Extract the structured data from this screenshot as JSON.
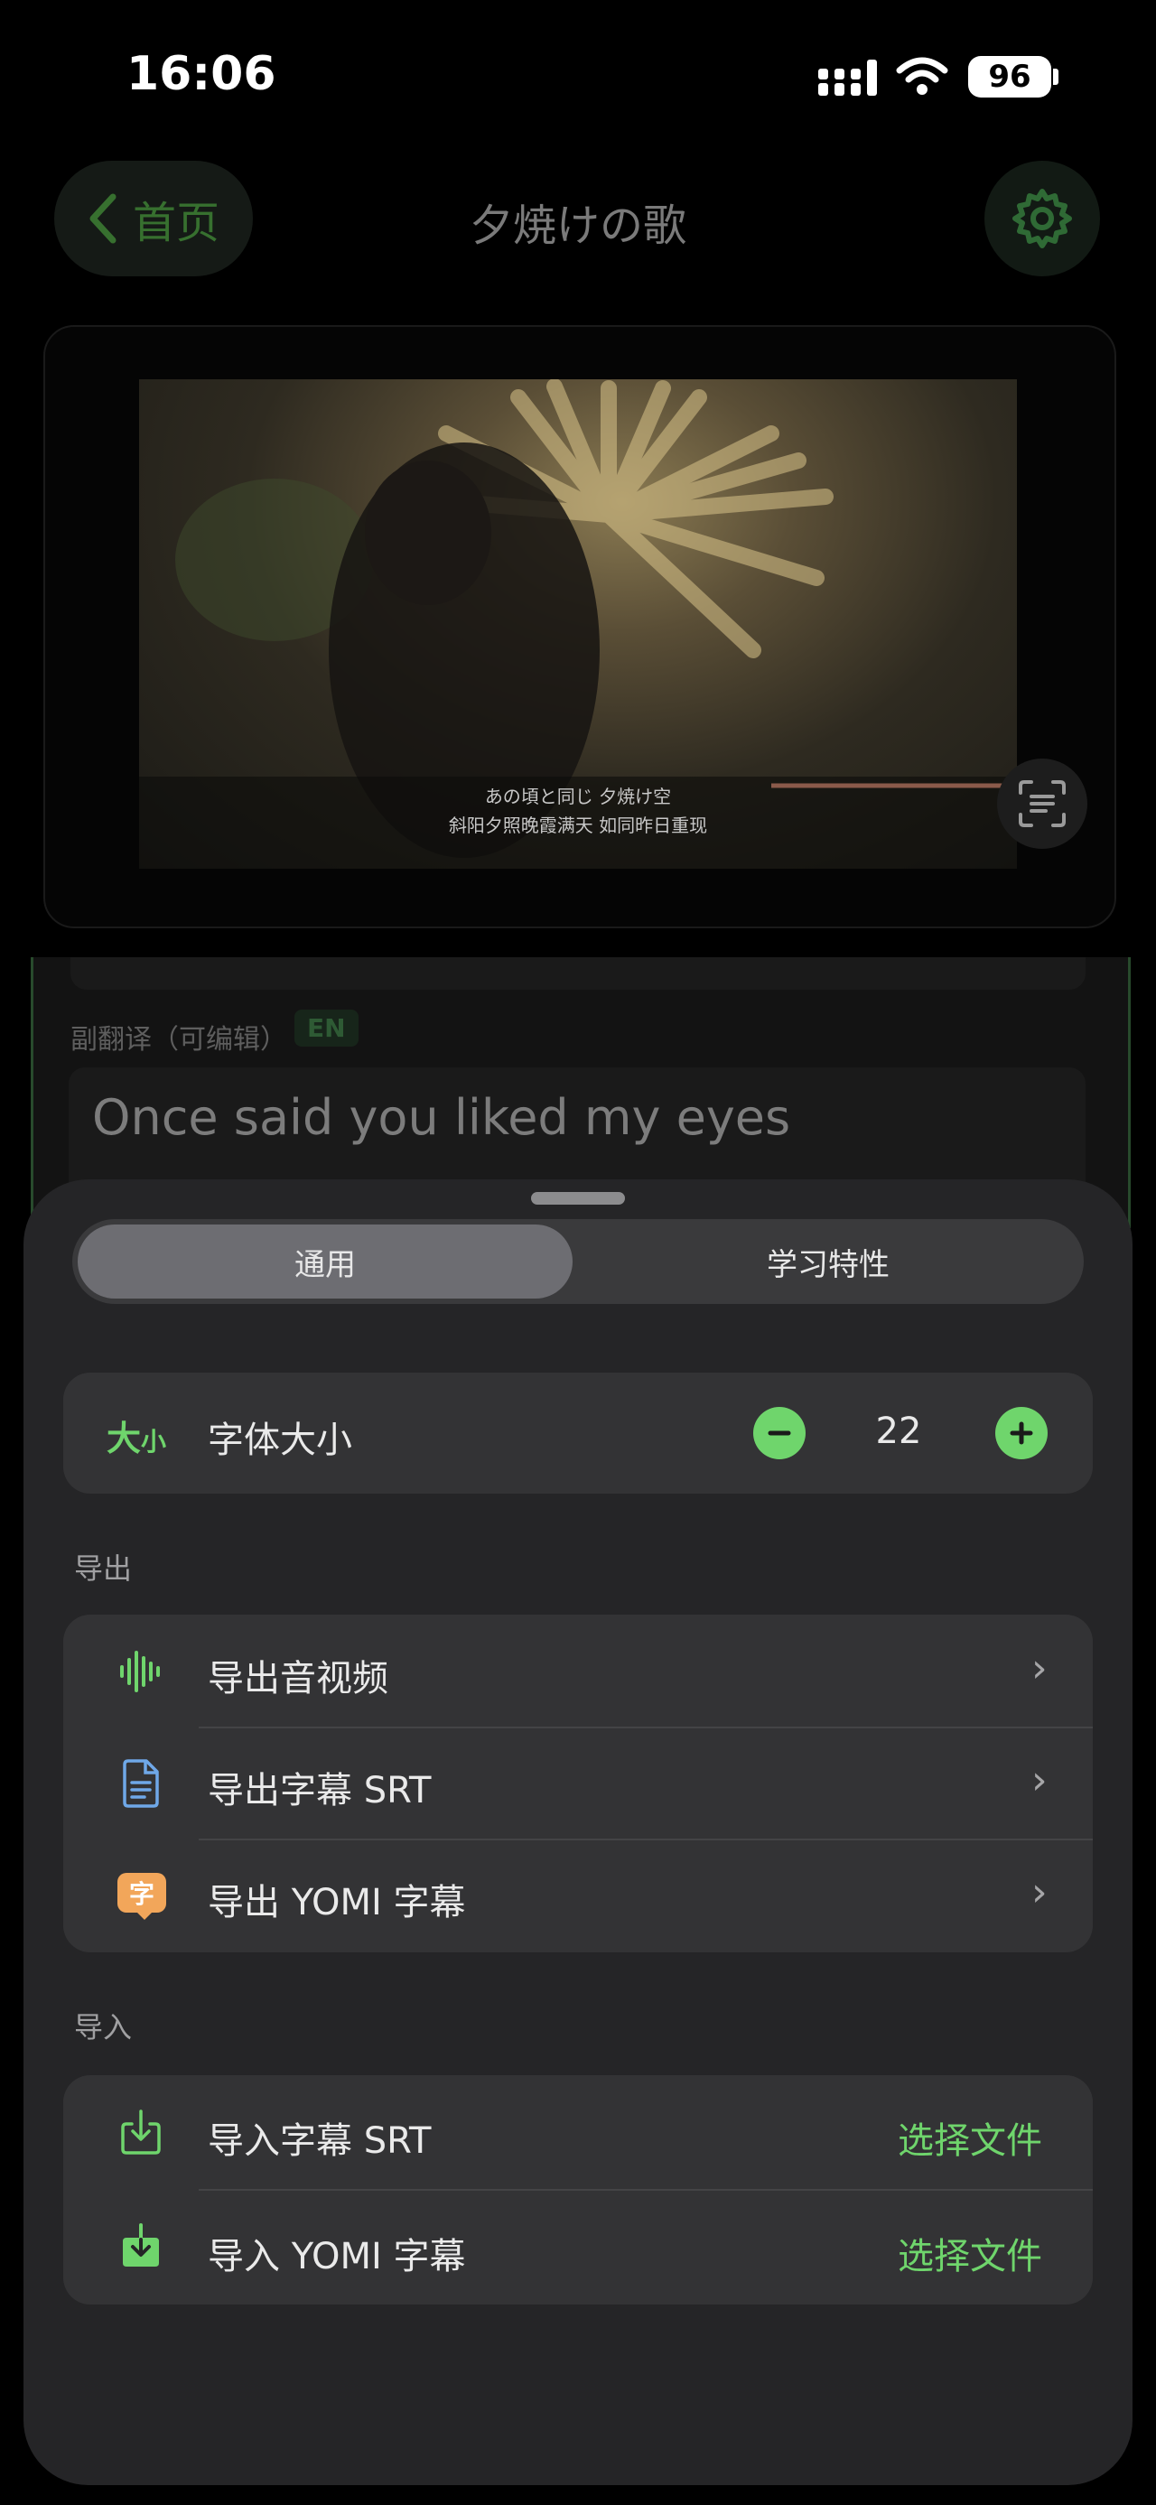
{
  "status_bar": {
    "time": "16:06",
    "battery": "96"
  },
  "nav": {
    "back_label": "首页",
    "title": "夕焼けの歌"
  },
  "video": {
    "subtitle_original": "あの頃と同じ 夕焼け空",
    "subtitle_translation": "斜阳夕照晚霞满天 如同昨日重现"
  },
  "editor": {
    "secondary_label": "副翻译（可编辑）",
    "language_badge": "EN",
    "secondary_text": "Once said you liked my eyes"
  },
  "sheet": {
    "tabs": [
      "通用",
      "学习特性"
    ],
    "font_size": {
      "icon_big": "大",
      "icon_small": "小",
      "label": "字体大小",
      "value": "22"
    },
    "export_section": "导出",
    "export_items": [
      "导出音视频",
      "导出字幕 SRT",
      "导出 YOMI 字幕"
    ],
    "export_yomi_icon_char": "字",
    "import_section": "导入",
    "import_items": [
      {
        "label": "导入字幕 SRT",
        "action": "选择文件"
      },
      {
        "label": "导入 YOMI 字幕",
        "action": "选择文件"
      }
    ]
  },
  "colors": {
    "accent": "#6FD56C",
    "sheet_bg": "#252527",
    "card_bg": "#333335"
  },
  "icons": [
    "back-chevron-icon",
    "gear-icon",
    "scan-text-icon",
    "minus-icon",
    "plus-icon",
    "waveform-icon",
    "document-icon",
    "chat-bubble-icon",
    "import-icon",
    "import-filled-icon"
  ]
}
